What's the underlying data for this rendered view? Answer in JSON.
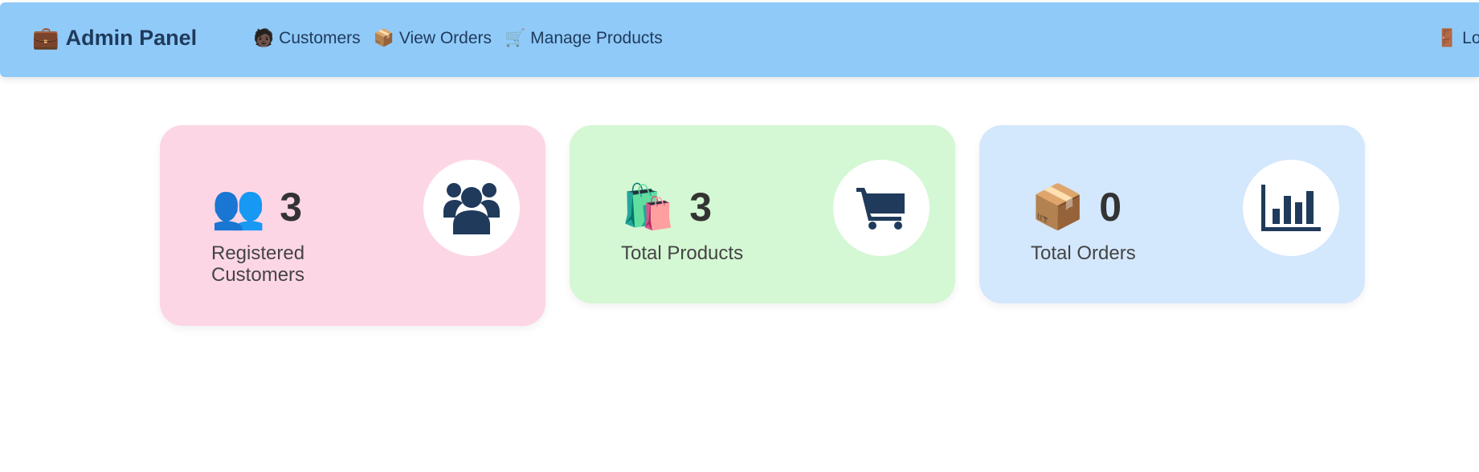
{
  "navbar": {
    "brand": {
      "icon": "briefcase-icon",
      "glyph": "💼",
      "label": "Admin Panel"
    },
    "links": [
      {
        "icon": "person-icon",
        "glyph": "🧑🏿",
        "label": "Customers"
      },
      {
        "icon": "package-icon",
        "glyph": "📦",
        "label": "View Orders"
      },
      {
        "icon": "shopping-cart-icon",
        "glyph": "🛒",
        "label": "Manage Products"
      }
    ],
    "logout": {
      "icon": "door-icon",
      "glyph": "🚪",
      "label": "Logout"
    }
  },
  "cards": [
    {
      "icon": "people-icon",
      "glyph": "👥",
      "count": "3",
      "label": "Registered Customers",
      "background": "#fdd6e6",
      "side_icon": "users-icon"
    },
    {
      "icon": "shopping-bags-icon",
      "glyph": "🛍️",
      "count": "3",
      "label": "Total Products",
      "background": "#d4f7d4",
      "side_icon": "cart-icon"
    },
    {
      "icon": "package-icon",
      "glyph": "📦",
      "count": "0",
      "label": "Total Orders",
      "background": "#d3e7fd",
      "side_icon": "bar-chart-icon"
    }
  ],
  "colors": {
    "navbar": "#90caf9",
    "nav_text": "#1f3a5b",
    "icon_dark": "#1f3a5b"
  }
}
